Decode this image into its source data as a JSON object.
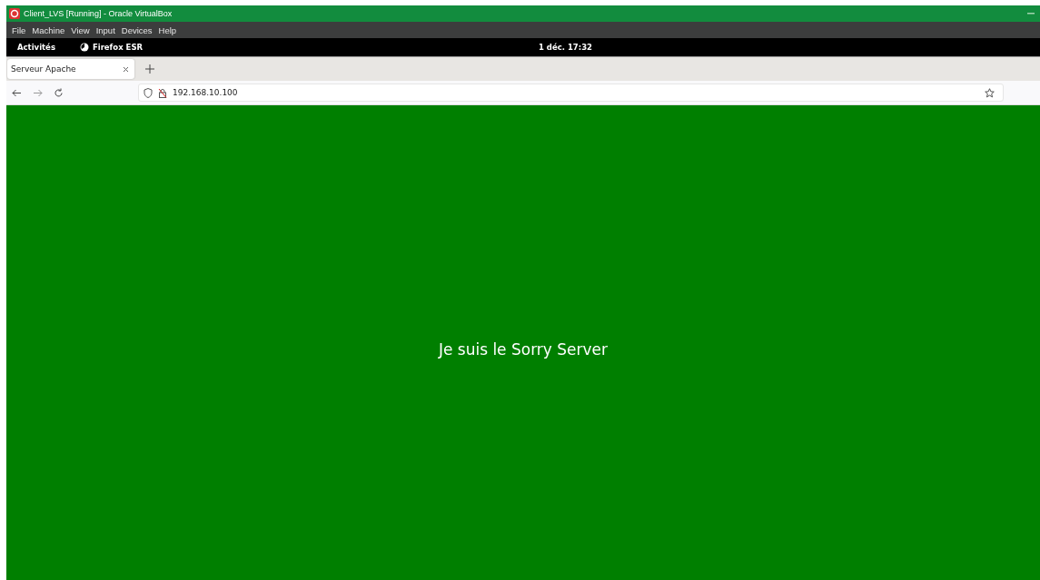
{
  "window": {
    "title": "Client_LVS [Running] - Oracle VirtualBox"
  },
  "menu": [
    "File",
    "Machine",
    "View",
    "Input",
    "Devices",
    "Help"
  ],
  "top_bar": {
    "activities": "Activités",
    "app": "Firefox ESR",
    "clock": "1 déc. 17:32"
  },
  "tabs": [
    {
      "label": "Serveur Apache",
      "selected": true
    }
  ],
  "address_bar": {
    "value": "192.168.10.100"
  },
  "page": {
    "message": "Je suis le Sorry Server"
  }
}
